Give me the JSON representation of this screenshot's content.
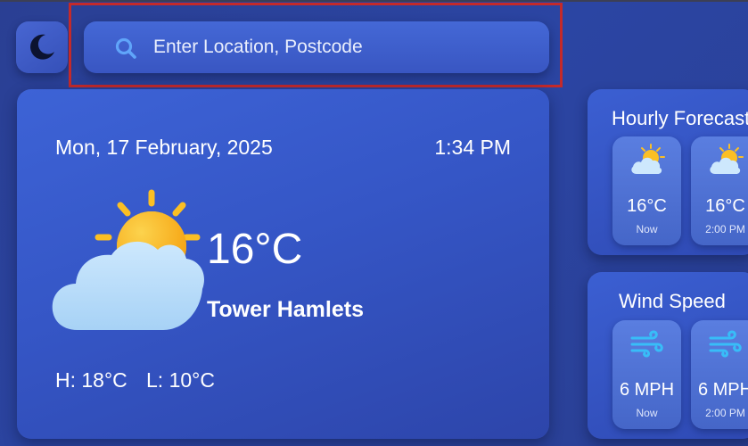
{
  "search": {
    "placeholder": "Enter Location, Postcode"
  },
  "theme_toggle": {
    "icon": "moon-icon"
  },
  "current": {
    "date": "Mon, 17 February, 2025",
    "time": "1:34 PM",
    "temperature": "16°C",
    "location": "Tower Hamlets",
    "high": "H: 18°C",
    "low": "L: 10°C",
    "icon": "partly-cloudy-icon"
  },
  "hourly": {
    "title": "Hourly Forecast",
    "items": [
      {
        "temp": "16°C",
        "label": "Now",
        "icon": "partly-cloudy-icon"
      },
      {
        "temp": "16°C",
        "label": "2:00 PM",
        "icon": "partly-cloudy-icon"
      }
    ]
  },
  "wind": {
    "title": "Wind Speed",
    "items": [
      {
        "speed": "6 MPH",
        "label": "Now",
        "icon": "wind-icon"
      },
      {
        "speed": "6 MPH",
        "label": "2:00 PM",
        "icon": "wind-icon"
      }
    ]
  },
  "colors": {
    "background": "#2b45a3",
    "card": "#3556c6",
    "highlight_frame": "#c42a2a",
    "sun": "#fbbf24",
    "cloud": "#b9dcf8",
    "wind": "#38bdf8"
  }
}
